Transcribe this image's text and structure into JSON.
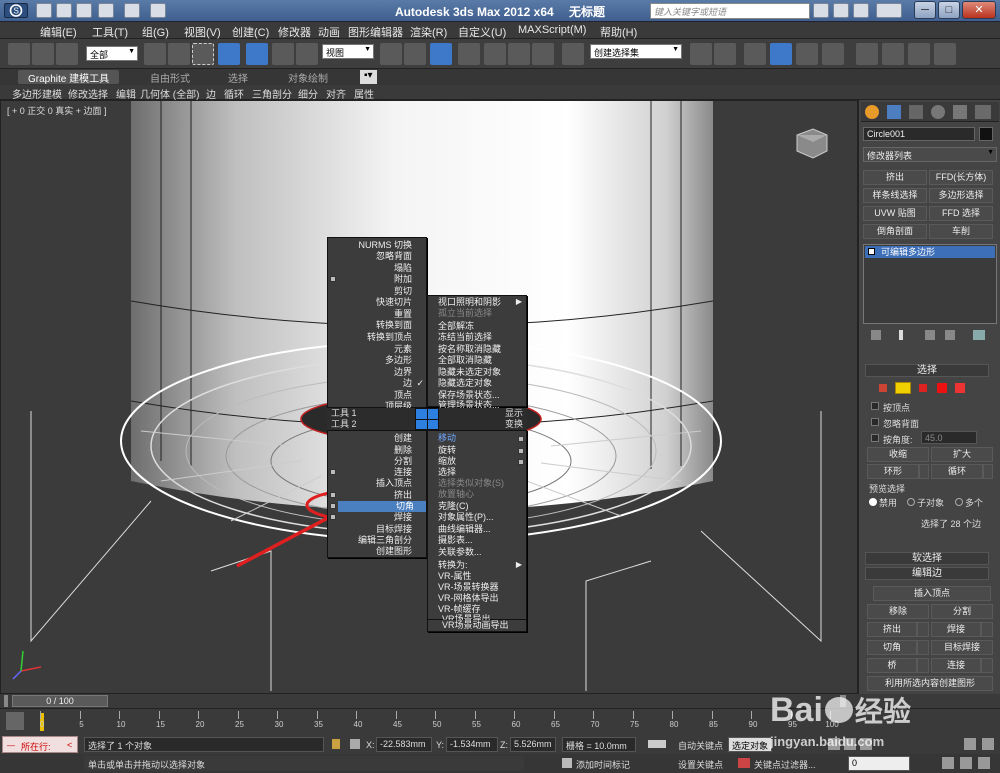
{
  "window": {
    "app_title": "Autodesk 3ds Max  2012 x64",
    "doc_title": "无标题",
    "search_placeholder": "键入关键字或短语",
    "controls": [
      "─",
      "□",
      "✕"
    ]
  },
  "menubar": {
    "items": [
      "编辑(E)",
      "工具(T)",
      "组(G)",
      "视图(V)",
      "创建(C)",
      "修改器",
      "动画",
      "图形编辑器",
      "渲染(R)",
      "自定义(U)",
      "MAXScript(M)",
      "帮助(H)"
    ]
  },
  "toolbar": {
    "filter_label": "全部",
    "coord_label": "视图",
    "selection_set_label": "创建选择集"
  },
  "ribbon": {
    "tabs": [
      "Graphite 建模工具",
      "自由形式",
      "选择",
      "对象绘制"
    ],
    "row": [
      "多边形建模",
      "修改选择",
      "编辑",
      "几何体 (全部)",
      "边",
      "循环",
      "三角剖分",
      "细分",
      "对齐",
      "属性"
    ]
  },
  "viewport": {
    "label": "[ + 0 正交 0 真实 + 边面 ]"
  },
  "quad_menu": {
    "upper_left": [
      "NURMS 切换",
      "忽略背面",
      "塌陷",
      "附加",
      "剪切",
      "快速切片",
      "重置",
      "转换到面",
      "转换到顶点",
      "元素",
      "多边形",
      "边界",
      "边",
      "顶点",
      "顶层级"
    ],
    "header_tools1": "工具 1",
    "header_tools2": "工具 2",
    "header_display": "显示",
    "header_transform": "变换",
    "upper_right": [
      "视口照明和阴影",
      "孤立当前选择",
      "全部解冻",
      "冻结当前选择",
      "按名称取消隐藏",
      "全部取消隐藏",
      "隐藏未选定对象",
      "隐藏选定对象",
      "保存场景状态...",
      "管理场景状态..."
    ],
    "lower_left": [
      "创建",
      "删除",
      "分割",
      "连接",
      "插入顶点",
      "挤出",
      "切角",
      "焊接",
      "目标焊接",
      "编辑三角剖分",
      "创建图形"
    ],
    "lower_right": [
      "移动",
      "旋转",
      "缩放",
      "选择",
      "选择类似对象(S)",
      "放置轴心",
      "克隆(C)",
      "对象属性(P)...",
      "曲线编辑器...",
      "摄影表...",
      "关联参数...",
      "转换为:",
      "VR-属性",
      "VR-场景转换器",
      "VR-网格体导出",
      "VR-帧缓存",
      "VR场景导出",
      "VR场景动画导出"
    ],
    "highlighted": "切角"
  },
  "panel": {
    "object_name": "Circle001",
    "modifier_list": "修改器列表",
    "buttons": [
      [
        "挤出",
        "FFD(长方体)"
      ],
      [
        "样条线选择",
        "多边形选择"
      ],
      [
        "UVW 贴图",
        "FFD 选择"
      ],
      [
        "倒角剖面",
        "车削"
      ]
    ],
    "stack_item": "可编辑多边形",
    "rollout_select": "选择",
    "by_vertex": "按顶点",
    "ignore_back": "忽略背面",
    "by_angle": "按角度:",
    "angle_value": "45.0",
    "shrink": "收缩",
    "grow": "扩大",
    "ring": "环形",
    "loop": "循环",
    "preview_label": "预览选择",
    "preview_options": [
      "禁用",
      "子对象",
      "多个"
    ],
    "selected_count": "选择了 28 个边",
    "soft_select": "软选择",
    "edit_edges": "编辑边",
    "insert_vertex": "插入顶点",
    "remove": "移除",
    "split": "分割",
    "extrude": "挤出",
    "weld": "焊接",
    "chamfer": "切角",
    "target_weld": "目标焊接",
    "bridge": "桥",
    "connect": "连接",
    "create_shape": "利用所选内容创建图形"
  },
  "timeline": {
    "frame_display": "0 / 100",
    "ticks": [
      "0",
      "5",
      "10",
      "15",
      "20",
      "25",
      "30",
      "35",
      "40",
      "45",
      "50",
      "55",
      "60",
      "65",
      "70",
      "75",
      "80",
      "85",
      "90",
      "95",
      "100"
    ]
  },
  "status": {
    "maxscript": "所在行:",
    "selected_msg": "选择了 1 个对象",
    "hint_msg": "单击或单击并拖动以选择对象",
    "x_label": "X:",
    "x_value": "-22.583mm",
    "y_label": "Y:",
    "y_value": "-1.534mm",
    "z_label": "Z:",
    "z_value": "5.526mm",
    "grid": "栅格 = 10.0mm",
    "add_time_tag": "添加时间标记",
    "auto_key": "自动关键点",
    "selected_obj": "选定对象",
    "set_key": "设置关键点",
    "key_filters": "关键点过滤器...",
    "frame_value": "0"
  },
  "watermark": {
    "brand": "Bai",
    "brand2": "经验",
    "url": "jingyan.baidu.com"
  },
  "colors": {
    "accent": "#4a7fc0",
    "annotation": "#e02020",
    "highlight": "#2d7fe0"
  }
}
